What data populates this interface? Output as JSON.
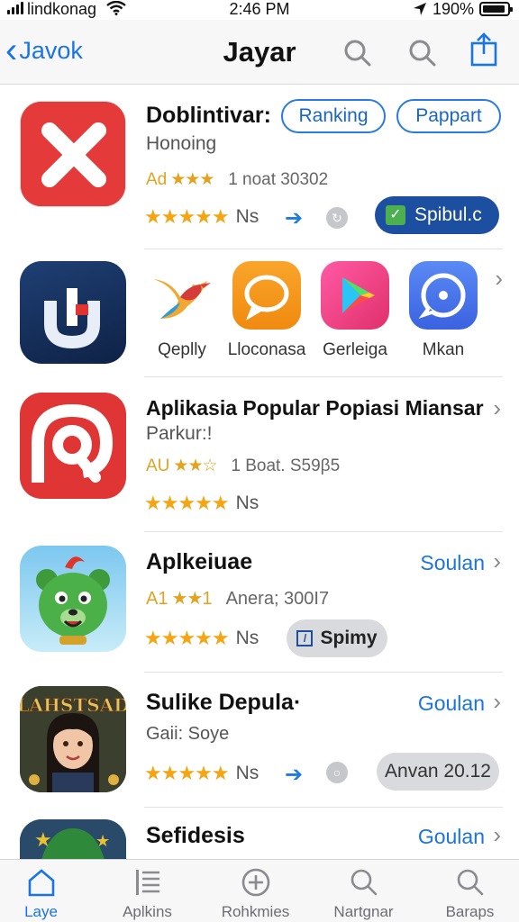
{
  "status": {
    "carrier": "lindkonag",
    "time": "2:46 PM",
    "battery": "190%"
  },
  "nav": {
    "back_label": "Javok",
    "title": "Jayar"
  },
  "row1": {
    "title": "Doblintivar:",
    "subtitle": "Honoing",
    "ad": "Ad",
    "mini_stars": "★★★",
    "meta": "1 noat 30302",
    "stars": "★★★★★",
    "rating_suffix": "Ns",
    "pill1": "Ranking",
    "pill2": "Pappart",
    "action": "Spibul.c",
    "icon": "close-x-icon"
  },
  "row2": {
    "apps": [
      {
        "label": "Qeplly",
        "icon": "bird-icon"
      },
      {
        "label": "Lloconasa",
        "icon": "chat-bubble-icon"
      },
      {
        "label": "Gerleiga",
        "icon": "play-store-icon"
      },
      {
        "label": "Mkan",
        "icon": "message-circle-icon"
      }
    ],
    "first_icon": "u-logo-icon"
  },
  "row3": {
    "title": "Aplikasia Popular Popiasi Miansar",
    "subtitle": "Parkur:!",
    "ad": "AU",
    "mini_stars": "★★☆",
    "meta": "1 Boat. S59β5",
    "stars": "★★★★★",
    "rating_suffix": "Ns",
    "icon": "pinterest-like-icon"
  },
  "row4": {
    "title": "Aplkeiuae",
    "link": "Soulan",
    "ad": "A1",
    "mini_stars": "★★",
    "meta_pre": "1",
    "meta": "Anera; 300I7",
    "stars": "★★★★★",
    "rating_suffix": "Ns",
    "action": "Spimy",
    "icon": "green-bear-icon"
  },
  "row5": {
    "title": "Sulike Depula·",
    "subtitle": "Gaii: Soye",
    "link": "Goulan",
    "stars": "★★★★★",
    "rating_suffix": "Ns",
    "action": "Anvan 20.12",
    "icon_text": "LAHSTSAD",
    "icon": "girl-portrait-icon"
  },
  "row6": {
    "title": "Sefidesis",
    "link": "Goulan",
    "icon": "green-hat-icon"
  },
  "tabs": [
    {
      "label": "Laye",
      "icon": "house-icon"
    },
    {
      "label": "Aplkins",
      "icon": "list-icon"
    },
    {
      "label": "Rohkmies",
      "icon": "plus-circle-icon"
    },
    {
      "label": "Nartgnar",
      "icon": "search-icon"
    },
    {
      "label": "Baraps",
      "icon": "search-icon"
    }
  ],
  "colors": {
    "accent": "#1a74e8",
    "star": "#f4a513",
    "dark_button": "#1d4fa0"
  }
}
